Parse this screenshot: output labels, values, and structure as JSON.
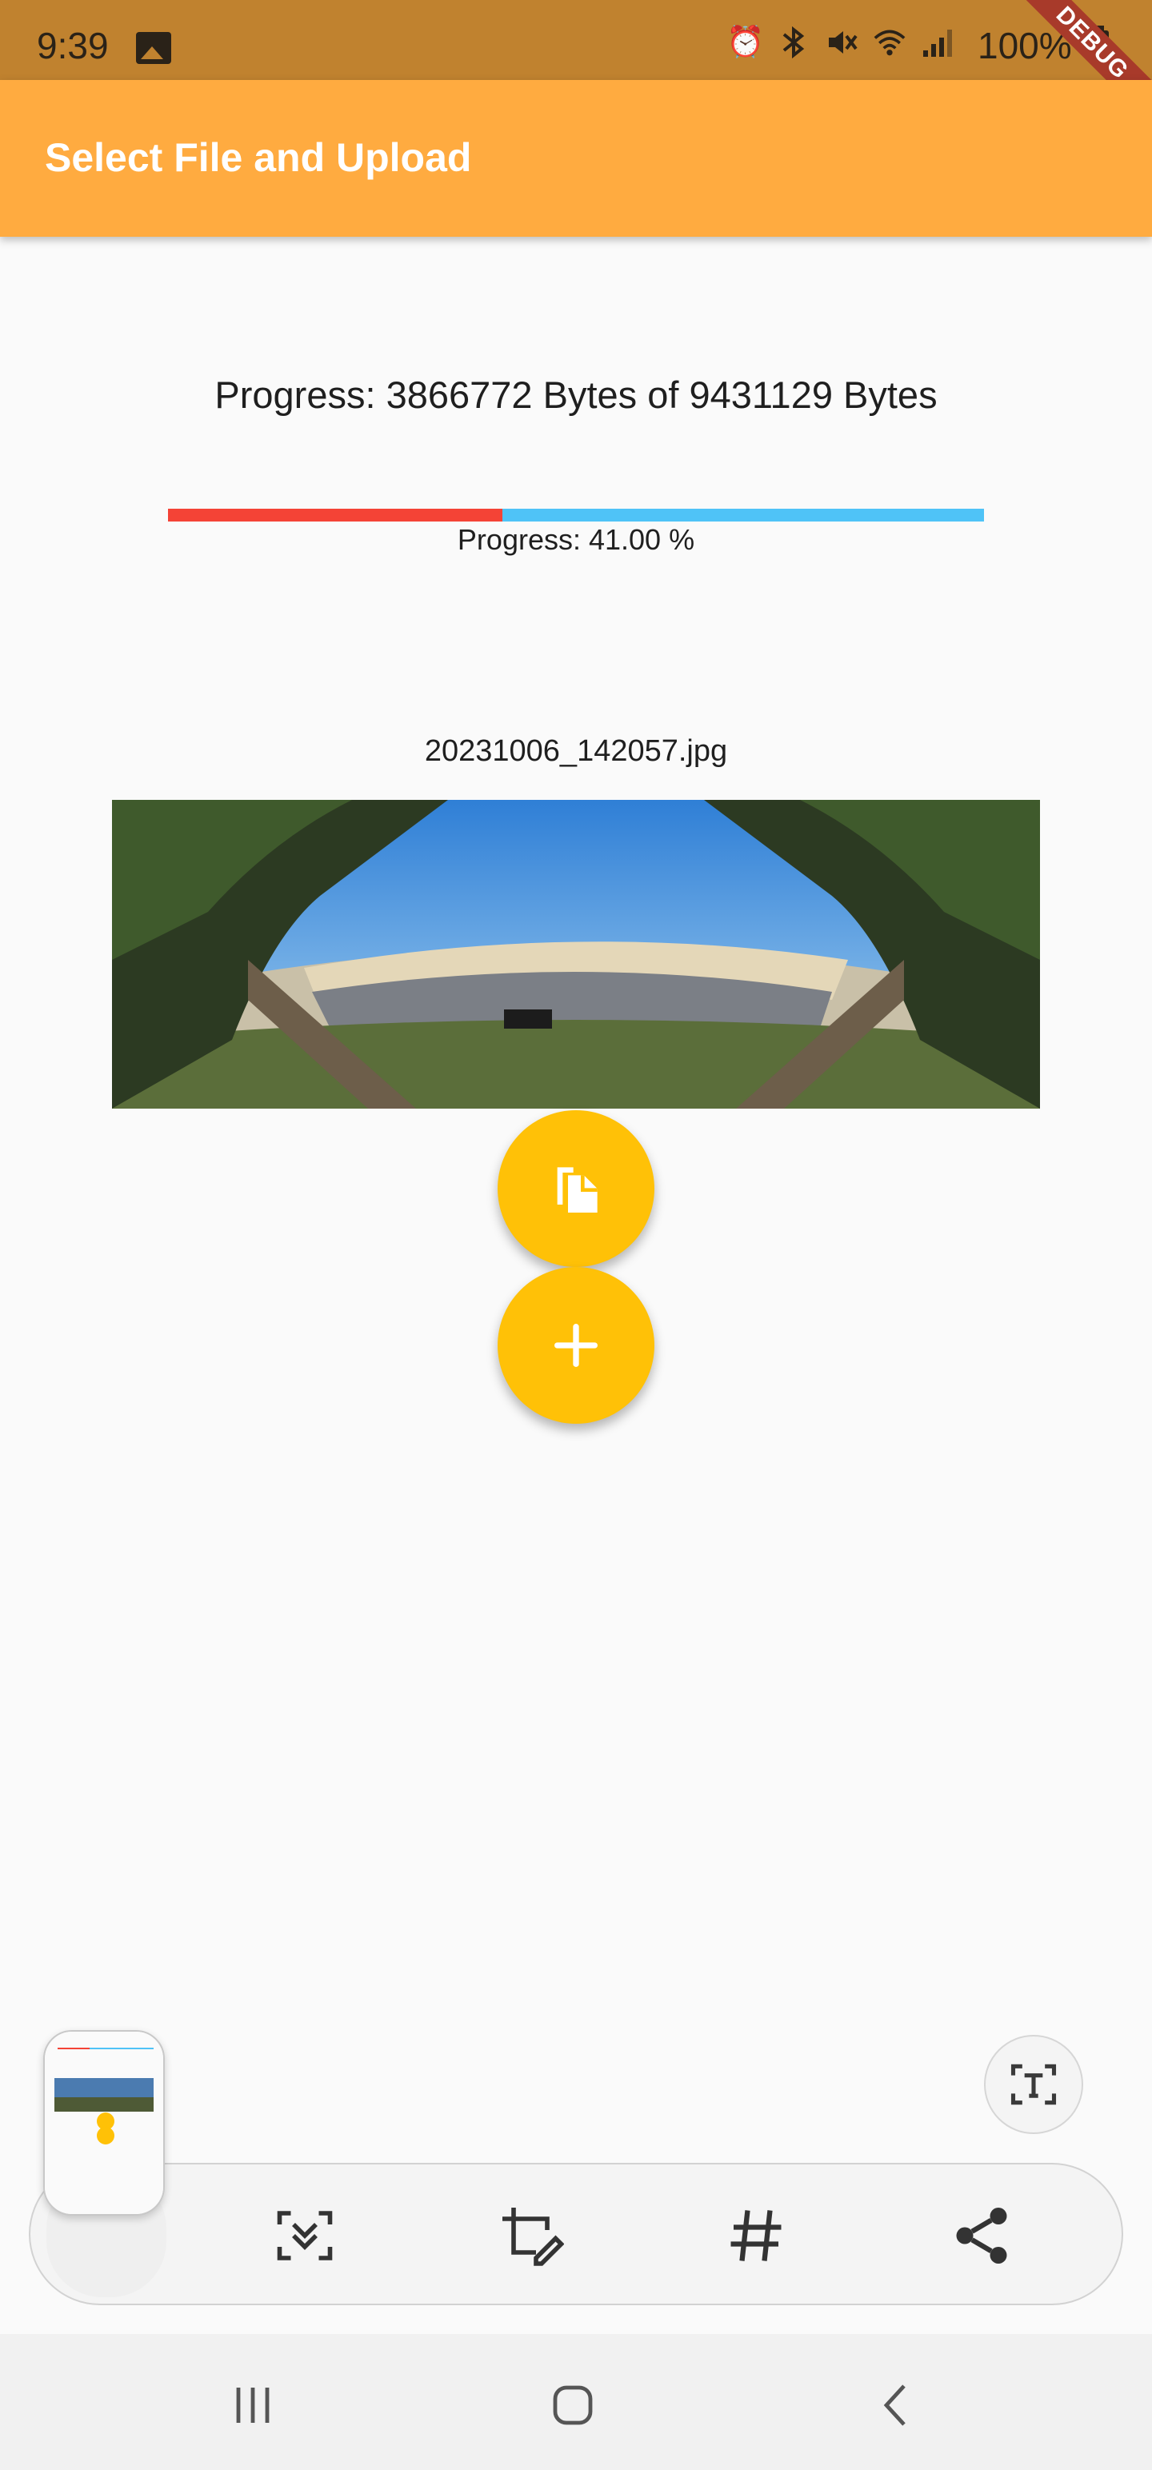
{
  "status_bar": {
    "time": "9:39",
    "battery": "100%",
    "icons": [
      "gallery-icon",
      "alarm-icon",
      "bluetooth-icon",
      "mute-icon",
      "wifi-icon",
      "signal-icon",
      "battery-icon"
    ]
  },
  "debug_banner": "DEBUG",
  "app_bar": {
    "title": "Select File and Upload"
  },
  "upload": {
    "bytes_text": "Progress: 3866772 Bytes of 9431129 Bytes",
    "percent_text": "Progress: 41.00 %",
    "progress_fraction": 0.41,
    "file_name": "20231006_142057.jpg"
  },
  "fabs": [
    {
      "name": "copy-file-button",
      "icon": "file-copy-icon"
    },
    {
      "name": "add-button",
      "icon": "plus-icon"
    }
  ],
  "screenshot_toolbar": {
    "tools": [
      "scroll-capture-icon",
      "crop-edit-icon",
      "hashtag-icon",
      "share-icon"
    ],
    "ocr_icon": "text-extract-icon"
  },
  "navigation": [
    "recent-apps-icon",
    "home-icon",
    "back-icon"
  ],
  "colors": {
    "app_bar": "#ffab40",
    "status_bar": "#c0822f",
    "fab": "#ffc107",
    "progress_fill": "#f44336",
    "progress_track": "#4fc3f7"
  }
}
